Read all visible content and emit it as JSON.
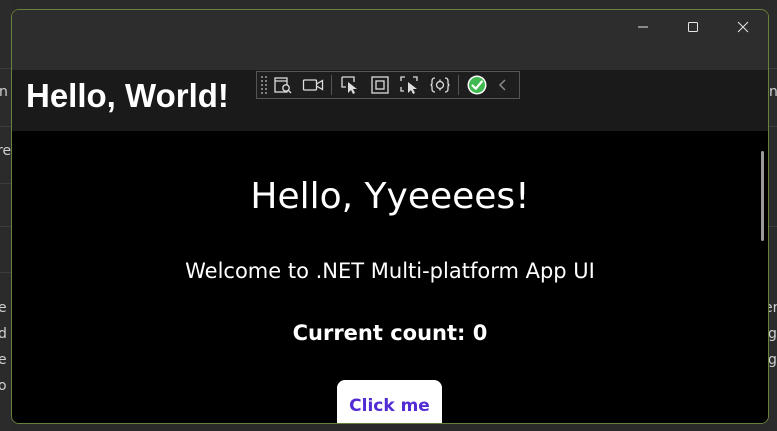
{
  "background_app": {
    "left_fragments": [
      "n",
      "re",
      "e",
      "d",
      "e",
      "o"
    ],
    "right_fragments": [
      "n",
      "er",
      "g",
      "g"
    ]
  },
  "window": {
    "caption": {
      "minimize_icon": "minimize-icon",
      "maximize_icon": "maximize-icon",
      "close_icon": "close-icon"
    },
    "nav_title": "Hello, World!",
    "debug_toolbar": {
      "items": [
        "live-visual-tree-icon",
        "video-camera-icon",
        "select-element-icon",
        "display-adorners-icon",
        "track-focus-icon",
        "xaml-hot-reload-icon",
        "hot-reload-status-check-icon",
        "collapse-chevron-icon"
      ],
      "status_color": "#3fb950"
    },
    "content": {
      "greeting": "Hello, Yyeeees!",
      "welcome": "Welcome to .NET Multi-platform App UI",
      "counter": "Current count: 0",
      "button_label": "Click me"
    },
    "colors": {
      "accent": "#512bd4",
      "border": "#6a7f3a",
      "titlebar": "#2d2d2d",
      "navbar": "#1a1a1a"
    }
  }
}
